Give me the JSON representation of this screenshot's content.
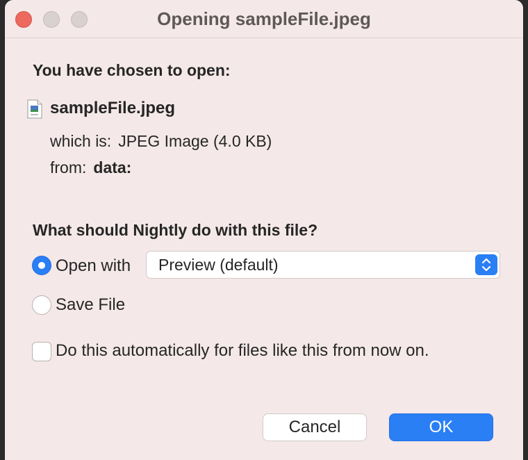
{
  "window": {
    "title": "Opening sampleFile.jpeg"
  },
  "dialog": {
    "chosen_heading": "You have chosen to open:",
    "file": {
      "name": "sampleFile.jpeg",
      "icon": "jpeg-file-icon",
      "type_label": "which is:",
      "type_value": "JPEG Image (4.0 KB)",
      "from_label": "from:",
      "from_value": "data:"
    },
    "action_heading": "What should Nightly do with this file?",
    "options": {
      "open_with_label": "Open with",
      "open_with_selected": true,
      "app_select_value": "Preview (default)",
      "save_file_label": "Save File",
      "save_file_selected": false
    },
    "auto_checkbox": {
      "label": "Do this automatically for files like this from now on.",
      "checked": false
    },
    "buttons": {
      "cancel": "Cancel",
      "ok": "OK"
    }
  },
  "colors": {
    "accent": "#2a7ff5",
    "window_bg": "#f4e8e8",
    "close_button": "#ed6a5e"
  }
}
